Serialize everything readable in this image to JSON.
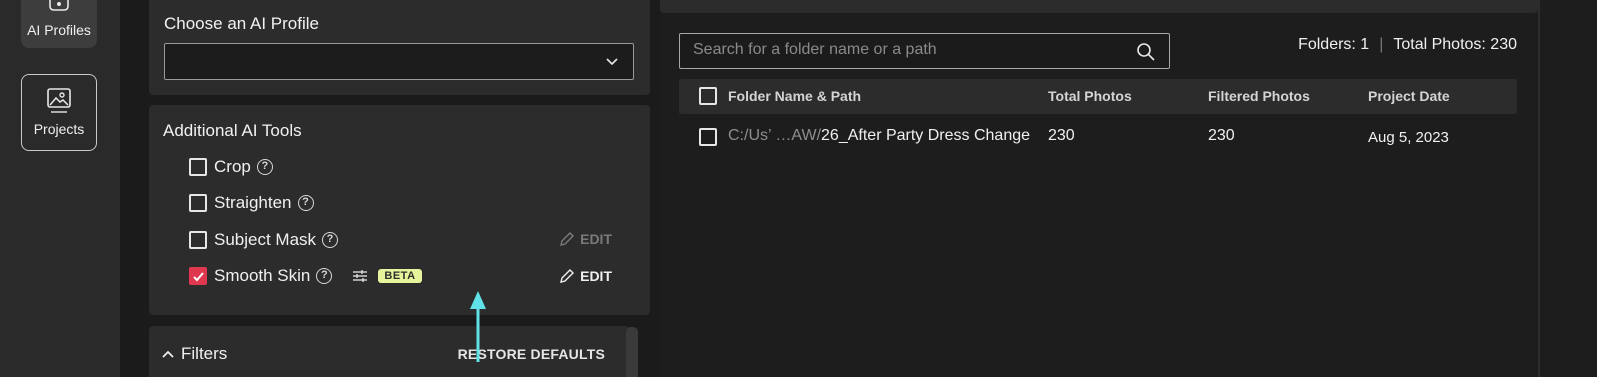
{
  "rail": {
    "ai_profiles_label": "AI Profiles",
    "projects_label": "Projects"
  },
  "profile": {
    "label": "Choose an AI Profile",
    "selected": ""
  },
  "tools": {
    "title": "Additional AI Tools",
    "items": [
      {
        "label": "Crop",
        "checked": false
      },
      {
        "label": "Straighten",
        "checked": false
      },
      {
        "label": "Subject Mask",
        "checked": false,
        "edit": "EDIT",
        "edit_enabled": false
      },
      {
        "label": "Smooth Skin",
        "checked": true,
        "badge": "BETA",
        "edit": "EDIT",
        "edit_enabled": true
      }
    ]
  },
  "filters": {
    "label": "Filters",
    "restore": "RESTORE DEFAULTS"
  },
  "search": {
    "placeholder": "Search for a folder name or a path"
  },
  "stats": {
    "folders": "Folders: 1",
    "photos": "Total Photos: 230"
  },
  "table": {
    "columns": [
      "Folder Name & Path",
      "Total Photos",
      "Filtered Photos",
      "Project Date"
    ],
    "rows": [
      {
        "path_prefix": "C:/Us’ …AW/",
        "folder": "26_After Party Dress Change",
        "total": "230",
        "filtered": "230",
        "date": "Aug 5, 2023"
      }
    ]
  },
  "colors": {
    "accent": "#e0394f",
    "beta": "#e8f49c",
    "arrow": "#5fe3e8"
  }
}
